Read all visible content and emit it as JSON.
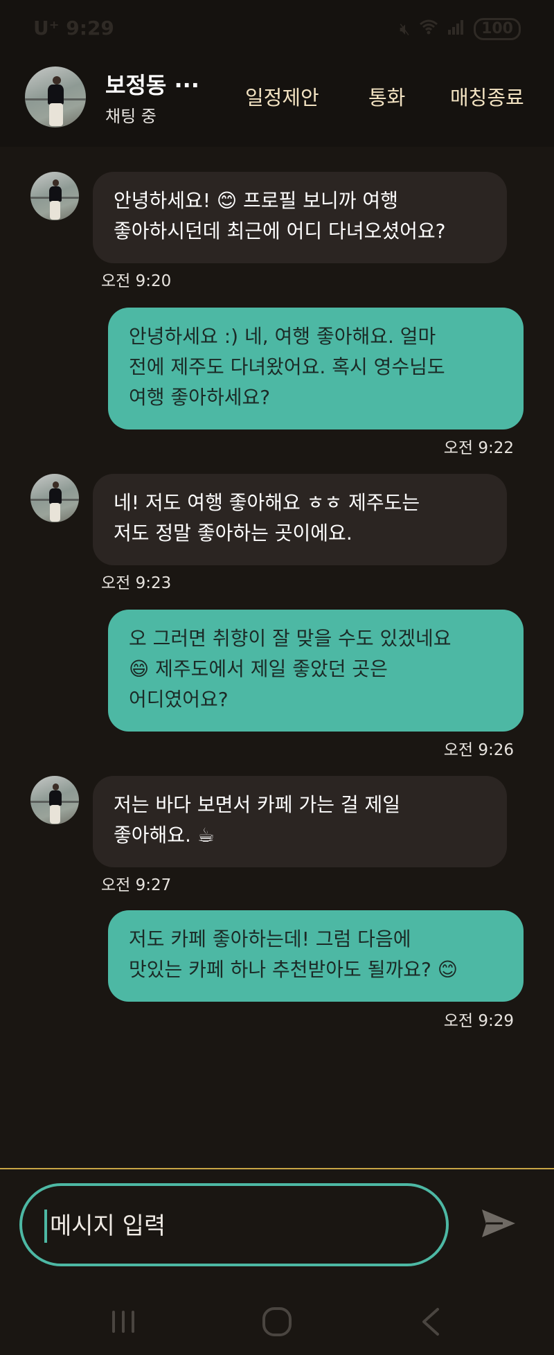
{
  "status_bar": {
    "carrier": "U⁺ 9:29",
    "battery": "100"
  },
  "header": {
    "name": "보정동 ···",
    "status": "채팅 중",
    "actions": {
      "schedule": "일정제안",
      "call": "통화",
      "end_match": "매칭종료"
    }
  },
  "messages": [
    {
      "direction": "in",
      "text": "안녕하세요! 😊 프로필 보니까 여행\n좋아하시던데 최근에 어디 다녀오셨어요?",
      "time": "오전 9:20"
    },
    {
      "direction": "out",
      "text": "안녕하세요 :) 네, 여행 좋아해요. 얼마\n전에 제주도 다녀왔어요. 혹시 영수님도\n여행 좋아하세요?",
      "time": "오전 9:22"
    },
    {
      "direction": "in",
      "text": "네! 저도 여행 좋아해요 ㅎㅎ 제주도는\n저도 정말 좋아하는 곳이에요.",
      "time": "오전 9:23"
    },
    {
      "direction": "out",
      "text": "오 그러면 취향이 잘 맞을 수도 있겠네요\n😄 제주도에서 제일 좋았던 곳은\n어디였어요?",
      "time": "오전 9:26"
    },
    {
      "direction": "in",
      "text": "저는 바다 보면서 카페 가는 걸 제일\n좋아해요. ☕",
      "time": "오전 9:27"
    },
    {
      "direction": "out",
      "text": "저도 카페 좋아하는데! 그럼 다음에\n맛있는 카페 하나 추천받아도 될까요? 😊",
      "time": "오전 9:29"
    }
  ],
  "composer": {
    "placeholder": "메시지 입력"
  },
  "icons": {
    "send": "send-icon",
    "nav_recent": "recent-apps-icon",
    "nav_home": "home-icon",
    "nav_back": "back-icon"
  },
  "colors": {
    "background": "#1a1612",
    "incoming_bubble": "#2b2522",
    "outgoing_bubble": "#4db8a4",
    "accent_line": "#c9a646",
    "header_action": "#f3e3c2"
  }
}
